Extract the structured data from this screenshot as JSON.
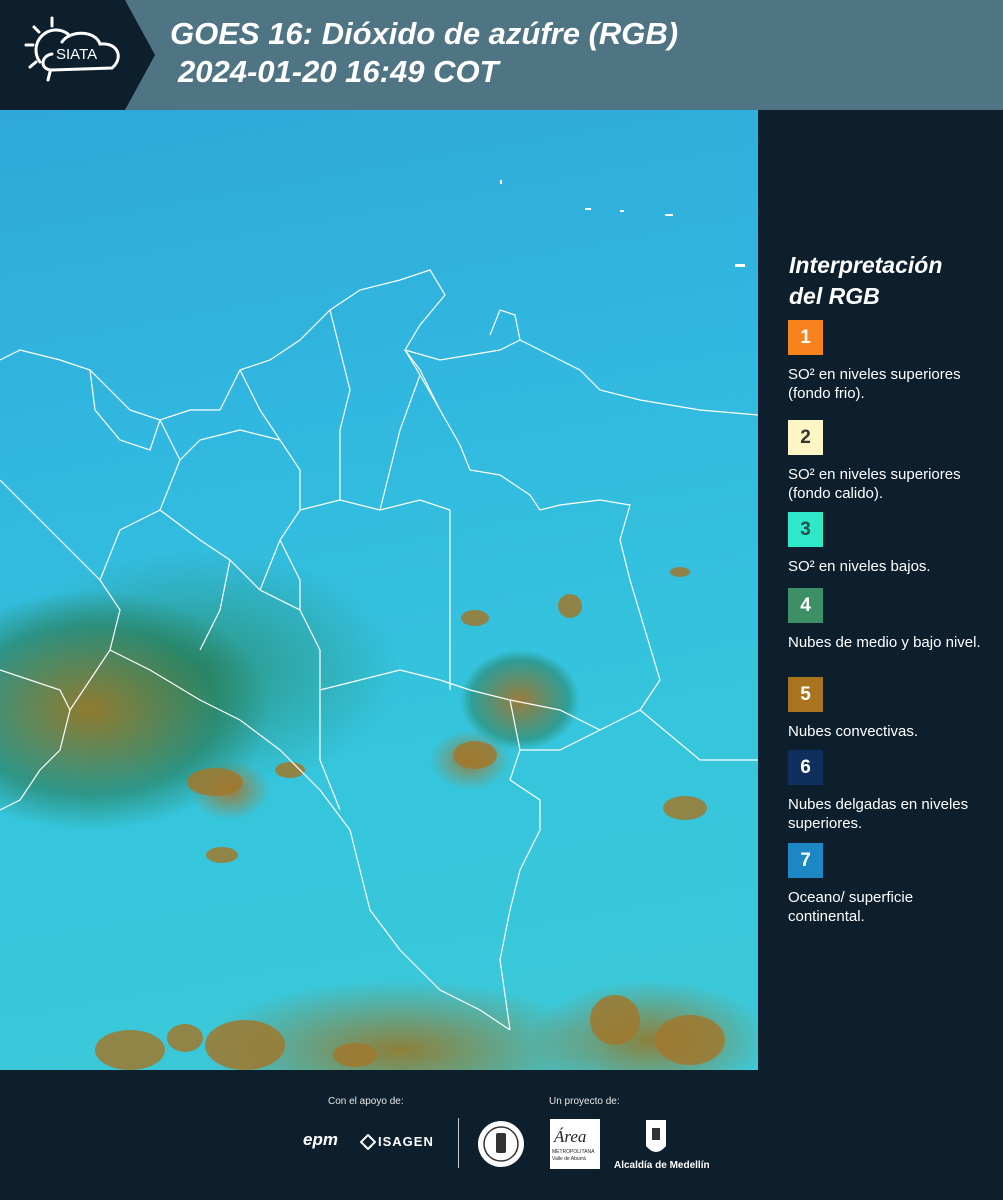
{
  "header": {
    "logo_text": "SIATA",
    "title_line1": "GOES 16: Dióxido de azúfre (RGB)",
    "title_line2": "2024-01-20 16:49 COT"
  },
  "legend": {
    "title_line1": "Interpretación",
    "title_line2": "del RGB",
    "items": [
      {
        "num": "1",
        "label": "SO² en niveles superiores (fondo frio).",
        "color": "#f7821e",
        "num_color": "#ffffff"
      },
      {
        "num": "2",
        "label": "SO² en niveles superiores (fondo calido).",
        "color": "#fdf5c4",
        "num_color": "#333333"
      },
      {
        "num": "3",
        "label": "SO² en niveles bajos.",
        "color": "#2ee8c9",
        "num_color": "#1b4f4a"
      },
      {
        "num": "4",
        "label": "Nubes de medio y bajo nivel.",
        "color": "#3d8f65",
        "num_color": "#ffffff"
      },
      {
        "num": "5",
        "label": "Nubes convectivas.",
        "color": "#a8741f",
        "num_color": "#ffffff"
      },
      {
        "num": "6",
        "label": "Nubes delgadas en niveles superiores.",
        "color": "#0f2f5e",
        "num_color": "#ffffff"
      },
      {
        "num": "7",
        "label": "Oceano/ superficie continental.",
        "color": "#1d86c4",
        "num_color": "#ffffff"
      }
    ]
  },
  "footer": {
    "support_label": "Con el apoyo de:",
    "project_label": "Un proyecto de:",
    "epm": "epm",
    "isagen": "ISAGEN",
    "area_text": "Área",
    "area_sub1": "METROPOLITANA",
    "area_sub2": "Valle de Aburrá",
    "alcaldia": "Alcaldía de Medellín"
  }
}
